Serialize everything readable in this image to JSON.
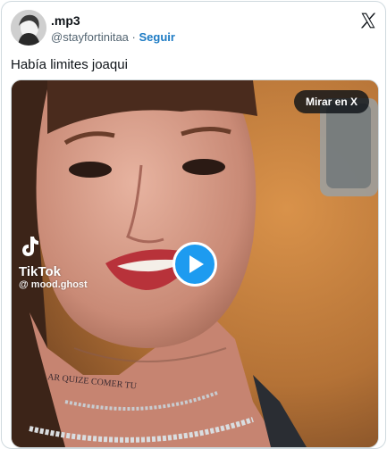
{
  "author": {
    "display_name": ".mp3",
    "handle": "@stayfortinitaa",
    "separator": "·",
    "follow_label": "Seguir",
    "avatar_icon": "avatar-photo"
  },
  "platform_icon": "x-logo-icon",
  "tweet": {
    "text": "Había limites joaqui"
  },
  "media": {
    "watch_label": "Mirar en X",
    "watermark_brand": "TikTok",
    "watermark_handle": "@ mood.ghost",
    "play_icon": "play-icon",
    "tattoo_text": "AR QUIZE COMER TU"
  },
  "colors": {
    "follow": "#1d7bc4",
    "play_button": "#1d9bf0",
    "border": "#cfd9de"
  }
}
